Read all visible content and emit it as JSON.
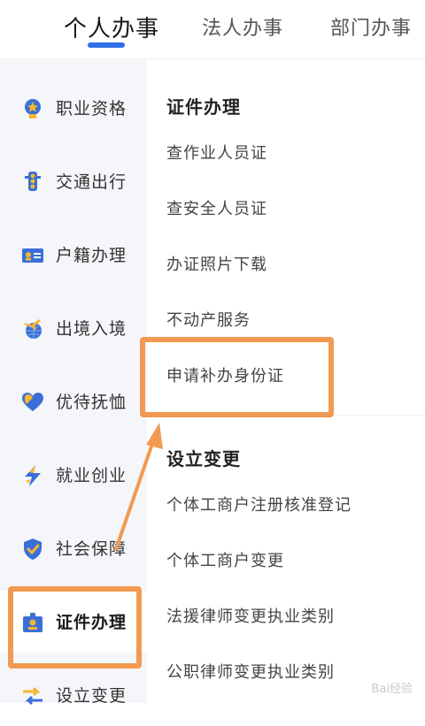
{
  "tabs": [
    {
      "label": "个人办事",
      "active": true
    },
    {
      "label": "法人办事",
      "active": false
    },
    {
      "label": "部门办事",
      "active": false
    }
  ],
  "sidebar": {
    "items": [
      {
        "label": "职业资格",
        "icon": "medal-icon"
      },
      {
        "label": "交通出行",
        "icon": "traffic-light-icon"
      },
      {
        "label": "户籍办理",
        "icon": "id-card-icon"
      },
      {
        "label": "出境入境",
        "icon": "globe-plane-icon"
      },
      {
        "label": "优待抚恤",
        "icon": "heart-icon"
      },
      {
        "label": "就业创业",
        "icon": "lightning-icon"
      },
      {
        "label": "社会保障",
        "icon": "shield-check-icon"
      },
      {
        "label": "证件办理",
        "icon": "id-badge-icon",
        "active": true
      },
      {
        "label": "设立变更",
        "icon": "exchange-icon"
      }
    ]
  },
  "content": {
    "sections": [
      {
        "title": "证件办理",
        "items": [
          "查作业人员证",
          "查安全人员证",
          "办证照片下载",
          "不动产服务",
          "申请补办身份证"
        ]
      },
      {
        "title": "设立变更",
        "items": [
          "个体工商户注册核准登记",
          "个体工商户变更",
          "法援律师变更执业类别",
          "公职律师变更执业类别"
        ]
      }
    ]
  },
  "colors": {
    "accent": "#2f6fe8",
    "highlight": "#f29a52",
    "sidebar_bg": "#f4f6fa",
    "icon_gold": "#f5b82e"
  }
}
